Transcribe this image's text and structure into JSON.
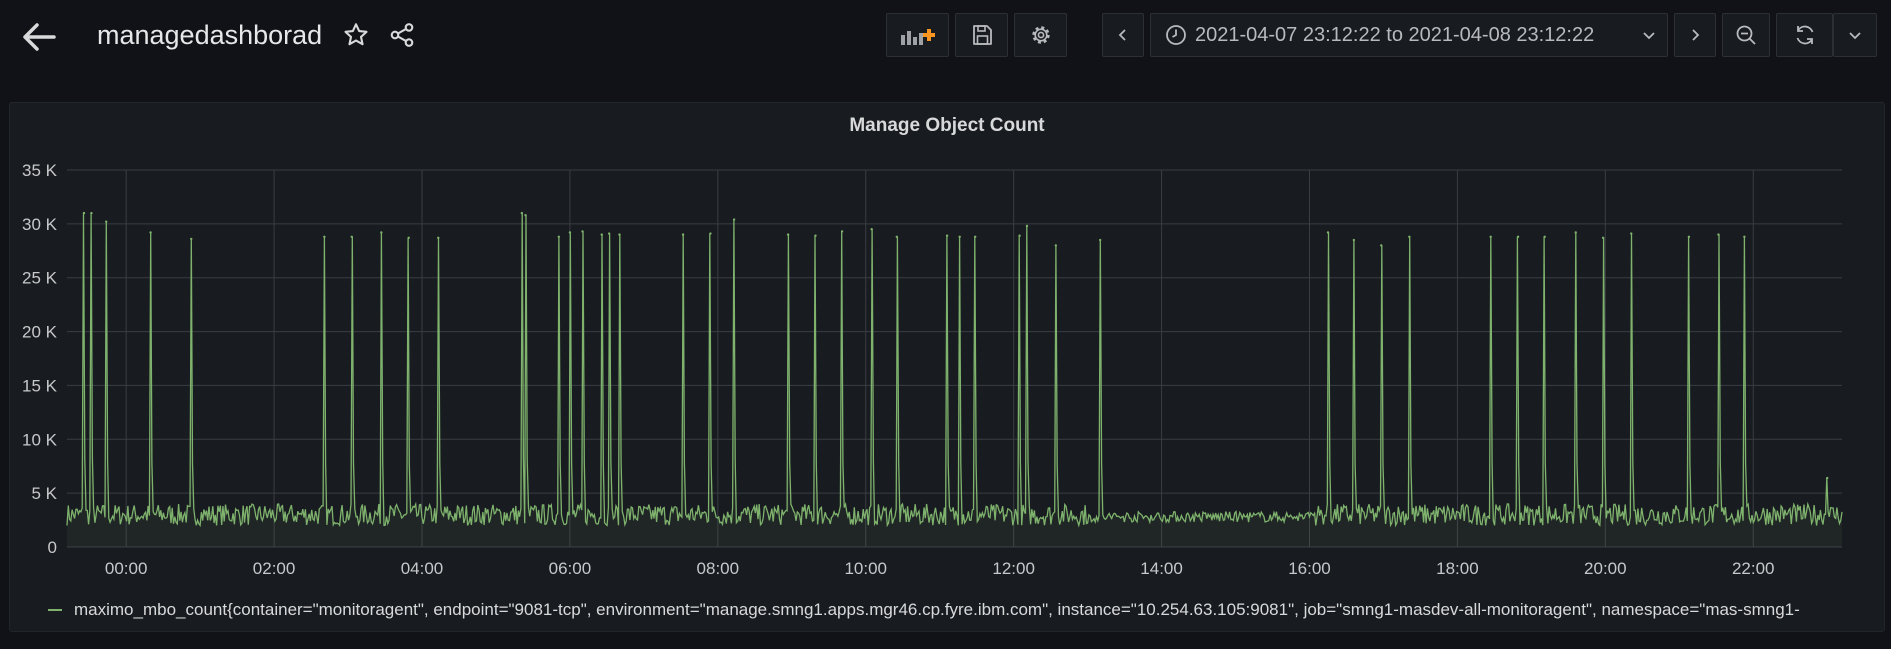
{
  "header": {
    "title": "managedashborad",
    "time_range_label": "2021-04-07 23:12:22 to 2021-04-08 23:12:22"
  },
  "colors": {
    "background": "#111217",
    "panel": "#181b1f",
    "series": "#7eb26d",
    "grid": "#3a3d44",
    "add_panel_accent": "#f79520"
  },
  "icons": [
    "back-arrow-icon",
    "star-icon",
    "share-icon",
    "add-panel-icon",
    "save-icon",
    "gear-icon",
    "chevron-left-icon",
    "clock-icon",
    "chevron-down-icon",
    "chevron-right-icon",
    "zoom-out-icon",
    "refresh-icon",
    "chevron-down-icon"
  ],
  "chart_data": {
    "type": "line",
    "title": "Manage Object Count",
    "xlabel": "",
    "ylabel": "",
    "ylim": [
      0,
      35000
    ],
    "y_ticks": [
      0,
      5000,
      10000,
      15000,
      20000,
      25000,
      30000,
      35000
    ],
    "y_tick_labels": [
      "0",
      "5 K",
      "10 K",
      "15 K",
      "20 K",
      "25 K",
      "30 K",
      "35 K"
    ],
    "x_tick_labels": [
      "00:00",
      "02:00",
      "04:00",
      "06:00",
      "08:00",
      "10:00",
      "12:00",
      "14:00",
      "16:00",
      "18:00",
      "20:00",
      "22:00"
    ],
    "x_ticks_hours": [
      0,
      2,
      4,
      6,
      8,
      10,
      12,
      14,
      16,
      18,
      20,
      22
    ],
    "xlim_hours": [
      -0.8,
      23.2
    ],
    "grid": true,
    "legend_position": "bottom-left",
    "baseline_range": [
      2000,
      4000
    ],
    "series": [
      {
        "name": "maximo_mbo_count{container=\"monitoragent\", endpoint=\"9081-tcp\", environment=\"manage.smng1.apps.mgr46.cp.fyre.ibm.com\", instance=\"10.254.63.105:9081\", job=\"smng1-masdev-all-monitoragent\", namespace=\"mas-smng1-",
        "color": "#7eb26d",
        "spikes": [
          {
            "x": -0.57,
            "y": 31000
          },
          {
            "x": -0.47,
            "y": 31000
          },
          {
            "x": -0.27,
            "y": 30200
          },
          {
            "x": 0.33,
            "y": 29200
          },
          {
            "x": 0.88,
            "y": 28600
          },
          {
            "x": 2.68,
            "y": 28800
          },
          {
            "x": 3.05,
            "y": 28800
          },
          {
            "x": 3.45,
            "y": 29200
          },
          {
            "x": 3.82,
            "y": 28700
          },
          {
            "x": 4.22,
            "y": 28700
          },
          {
            "x": 5.35,
            "y": 31000
          },
          {
            "x": 5.4,
            "y": 30800
          },
          {
            "x": 5.85,
            "y": 28800
          },
          {
            "x": 6.0,
            "y": 29200
          },
          {
            "x": 6.17,
            "y": 29300
          },
          {
            "x": 6.43,
            "y": 29000
          },
          {
            "x": 6.53,
            "y": 29100
          },
          {
            "x": 6.67,
            "y": 29000
          },
          {
            "x": 7.53,
            "y": 29000
          },
          {
            "x": 7.9,
            "y": 29100
          },
          {
            "x": 8.22,
            "y": 30400
          },
          {
            "x": 8.95,
            "y": 29000
          },
          {
            "x": 9.32,
            "y": 28900
          },
          {
            "x": 9.68,
            "y": 29300
          },
          {
            "x": 10.08,
            "y": 29500
          },
          {
            "x": 10.42,
            "y": 28800
          },
          {
            "x": 11.1,
            "y": 28900
          },
          {
            "x": 11.27,
            "y": 28800
          },
          {
            "x": 11.48,
            "y": 28800
          },
          {
            "x": 12.08,
            "y": 28900
          },
          {
            "x": 12.18,
            "y": 29800
          },
          {
            "x": 12.57,
            "y": 28000
          },
          {
            "x": 13.17,
            "y": 28500
          },
          {
            "x": 16.25,
            "y": 29200
          },
          {
            "x": 16.6,
            "y": 28500
          },
          {
            "x": 16.97,
            "y": 28000
          },
          {
            "x": 17.35,
            "y": 28800
          },
          {
            "x": 18.45,
            "y": 28800
          },
          {
            "x": 18.82,
            "y": 28800
          },
          {
            "x": 19.18,
            "y": 28800
          },
          {
            "x": 19.6,
            "y": 29200
          },
          {
            "x": 19.97,
            "y": 28700
          },
          {
            "x": 20.35,
            "y": 29100
          },
          {
            "x": 21.13,
            "y": 28800
          },
          {
            "x": 21.53,
            "y": 29000
          },
          {
            "x": 21.88,
            "y": 28800
          },
          {
            "x": 23.0,
            "y": 6400
          }
        ]
      }
    ]
  }
}
